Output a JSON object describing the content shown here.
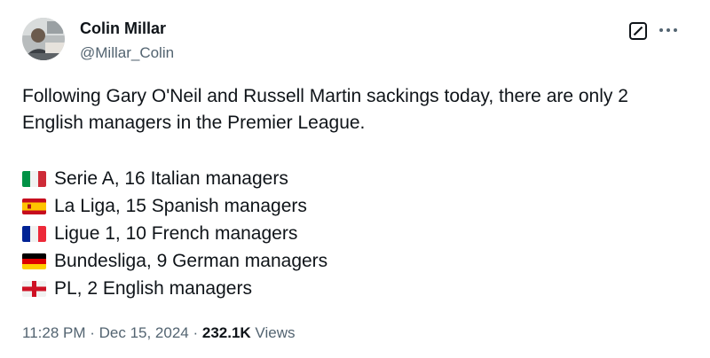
{
  "author": {
    "name": "Colin Millar",
    "handle": "@Millar_Colin"
  },
  "tweet": {
    "text": "Following Gary O'Neil and Russell Martin sackings today, there are only 2 English managers in the Premier League.",
    "list": [
      {
        "flag": "italy-flag-icon",
        "text": "Serie A, 16 Italian managers"
      },
      {
        "flag": "spain-flag-icon",
        "text": "La Liga, 15 Spanish managers"
      },
      {
        "flag": "france-flag-icon",
        "text": "Ligue 1, 10 French managers"
      },
      {
        "flag": "germany-flag-icon",
        "text": "Bundesliga, 9 German managers"
      },
      {
        "flag": "england-flag-icon",
        "text": "PL, 2 English managers"
      }
    ]
  },
  "meta": {
    "time": "11:28 PM",
    "sep1": " · ",
    "date": "Dec 15, 2024",
    "sep2": " · ",
    "views_count": "232.1K",
    "views_label": " Views"
  },
  "icons": {
    "grok": "grok-icon",
    "more": "more-icon"
  },
  "colors": {
    "text": "#0f1419",
    "secondary": "#536471"
  }
}
